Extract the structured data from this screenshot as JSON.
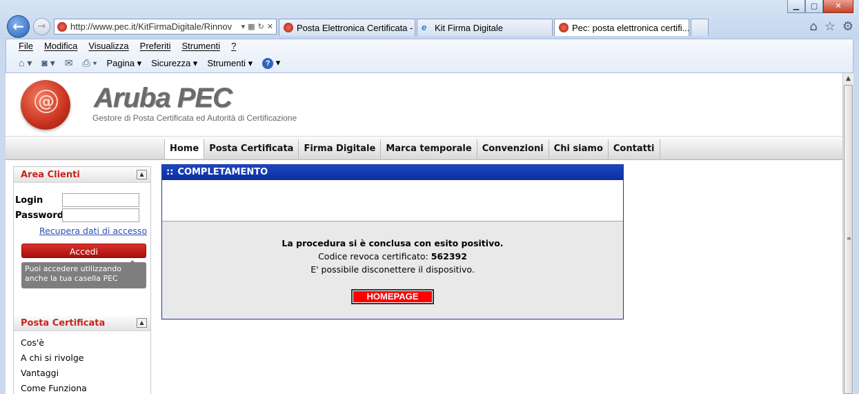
{
  "browser": {
    "url": "http://www.pec.it/KitFirmaDigitale/Rinnov",
    "url_host": "www.pec.it",
    "tabs": [
      {
        "label": "Posta Elettronica Certificata - F..."
      },
      {
        "label": "Kit Firma Digitale"
      },
      {
        "label": "Pec: posta elettronica certifi..."
      }
    ],
    "menu": [
      "File",
      "Modifica",
      "Visualizza",
      "Preferiti",
      "Strumenti",
      "?"
    ],
    "commands": [
      "Pagina",
      "Sicurezza",
      "Strumenti"
    ]
  },
  "header": {
    "brand": "Aruba PEC",
    "tagline": "Gestore di Posta Certificata ed Autorità di Certificazione"
  },
  "topnav": [
    "Home",
    "Posta Certificata",
    "Firma Digitale",
    "Marca temporale",
    "Convenzioni",
    "Chi siamo",
    "Contatti"
  ],
  "sidebar": {
    "area_title": "Area Clienti",
    "login_label": "Login",
    "password_label": "Password",
    "recover_link": "Recupera dati di accesso",
    "login_button": "Accedi",
    "tooltip": "Puoi accedere utilizzando anche la tua casella PEC",
    "section_title": "Posta Certificata",
    "links": [
      "Cos'è",
      "A chi si rivolge",
      "Vantaggi",
      "Come Funziona"
    ]
  },
  "panel": {
    "title": "COMPLETAMENTO",
    "message": "La procedura si è conclusa con esito positivo.",
    "revoke_label": "Codice revoca certificato:",
    "revoke_code": "562392",
    "disconnect_note": "E' possibile disconettere il dispositivo.",
    "button": "HOMEPAGE"
  },
  "colors": {
    "brand_red": "#c8231b",
    "panel_blue": "#1948c4",
    "button_red": "#ff0000"
  }
}
